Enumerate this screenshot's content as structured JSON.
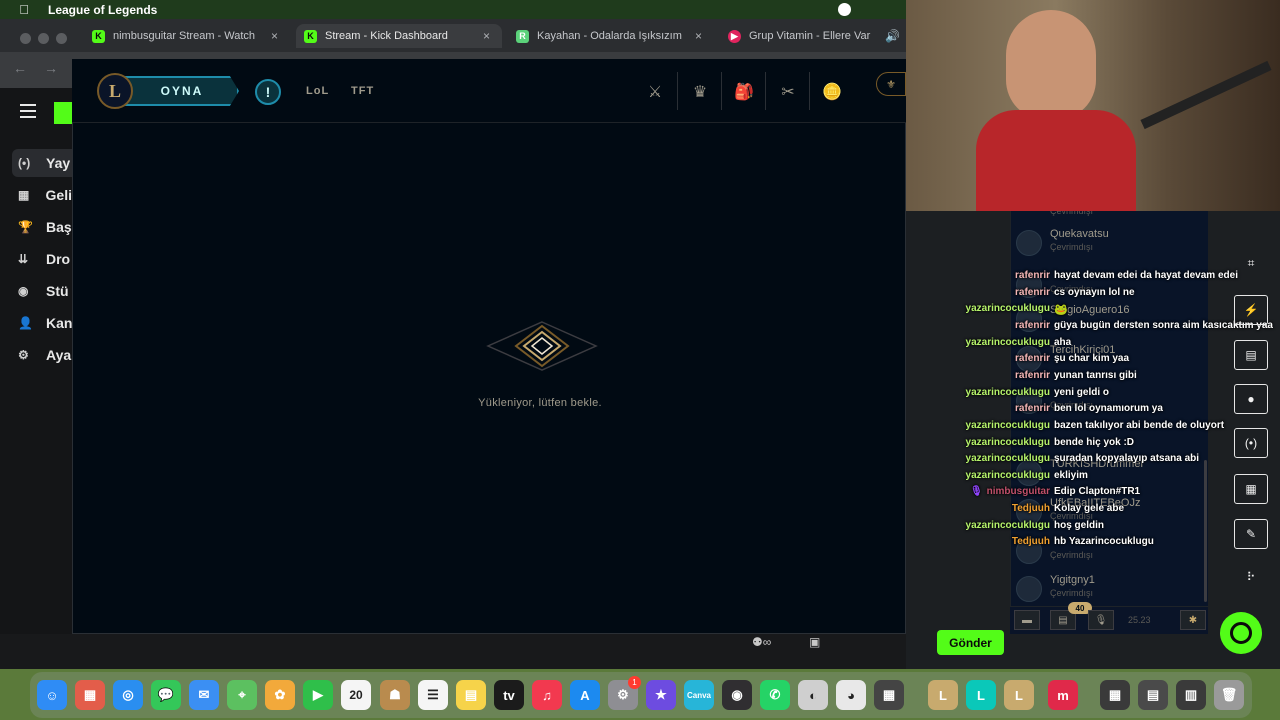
{
  "menubar": {
    "apple": "",
    "app_title": "League of Legends"
  },
  "tabs": [
    {
      "label": "nimbusguitar Stream - Watch",
      "favicon": "K",
      "color": "#53fc18",
      "close": "×"
    },
    {
      "label": "Stream - Kick Dashboard",
      "favicon": "K",
      "color": "#53fc18",
      "close": "×"
    },
    {
      "label": "Kayahan - Odalarda Işıksızım",
      "favicon": "R",
      "color": "#5bd27a",
      "close": "×"
    },
    {
      "label": "Grup Vitamin - Ellere Var",
      "favicon": "▶",
      "color": "#e0245e",
      "close": "🔊"
    }
  ],
  "kick_sidebar": [
    {
      "label": "Yay",
      "icon": "(•)"
    },
    {
      "label": "Geli",
      "icon": "▦"
    },
    {
      "label": "Baş",
      "icon": "🏆"
    },
    {
      "label": "Dro",
      "icon": "⇊"
    },
    {
      "label": "Stü",
      "icon": "◉"
    },
    {
      "label": "Kan",
      "icon": "👤"
    },
    {
      "label": "Aya",
      "icon": "⚙"
    }
  ],
  "lol": {
    "logo": "L",
    "play_label": "OYNA",
    "alert": "!",
    "tabs": [
      "LoL",
      "TFT"
    ],
    "nav_icons": [
      "⚔",
      "♛",
      "🎒",
      "✂",
      "🪙"
    ],
    "currency": "⚜",
    "loading_text": "Yükleniyor, lütfen bekle."
  },
  "friends": [
    {
      "name": "Çevrimdışı",
      "status": ""
    },
    {
      "name": "Quekavatsu",
      "status": "Çevrimdışı"
    },
    {
      "name": "",
      "status": "Çevrimdışı"
    },
    {
      "name": "SergioAguero16",
      "status": ""
    },
    {
      "name": "TercihKirici01",
      "status": ""
    },
    {
      "name": "",
      "status": "Çevrimdışı"
    },
    {
      "name": "TURKISHDrummer",
      "status": ""
    },
    {
      "name": "UfkEBaIITEBeOJz",
      "status": "Çevrimdışı"
    },
    {
      "name": "",
      "status": "Çevrimdışı"
    },
    {
      "name": "Yigitgny1",
      "status": "Çevrimdışı"
    }
  ],
  "friends_bar": {
    "badge": "40",
    "time": "25.23"
  },
  "chat": [
    {
      "user": "rafenrir",
      "msg": "hayat devam edei da hayat devam edei",
      "color": "#f4b6b6"
    },
    {
      "user": "rafenrir",
      "msg": "cs oynayın lol ne",
      "color": "#f4b6b6"
    },
    {
      "user": "yazarincocuklugu",
      "msg": "",
      "color": "#b6f36b"
    },
    {
      "user": "rafenrir",
      "msg": "güya bugün dersten sonra aim kasıcaktım yaa",
      "color": "#f4b6b6"
    },
    {
      "user": "yazarincocuklugu",
      "msg": "aha",
      "color": "#b6f36b"
    },
    {
      "user": "rafenrir",
      "msg": "şu char kim yaa",
      "color": "#f4b6b6"
    },
    {
      "user": "rafenrir",
      "msg": "yunan tanrısı gibi",
      "color": "#f4b6b6"
    },
    {
      "user": "yazarincocuklugu",
      "msg": "yeni geldi o",
      "color": "#b6f36b"
    },
    {
      "user": "rafenrir",
      "msg": "ben lol oynamıorum ya",
      "color": "#f4b6b6"
    },
    {
      "user": "yazarincocuklugu",
      "msg": "bazen takılıyor abi bende de oluyort",
      "color": "#b6f36b"
    },
    {
      "user": "yazarincocuklugu",
      "msg": "bende hiç yok :D",
      "color": "#b6f36b"
    },
    {
      "user": "yazarincocuklugu",
      "msg": "şuradan kopyalayıp atsana abi",
      "color": "#b6f36b"
    },
    {
      "user": "yazarincocuklugu",
      "msg": "ekliyim",
      "color": "#b6f36b"
    },
    {
      "user": "nimbusguitar",
      "msg": "Edip Clapton#TR1",
      "color": "#c0506a"
    },
    {
      "user": "Tedjuuh",
      "msg": "Kolay gele abe",
      "color": "#f0a030"
    },
    {
      "user": "yazarincocuklugu",
      "msg": "hoş geldin",
      "color": "#b6f36b"
    },
    {
      "user": "Tedjuuh",
      "msg": "hb Yazarincocuklugu",
      "color": "#f0a030"
    }
  ],
  "kick_bottom": {
    "send_label": "Gönder"
  },
  "dock": [
    {
      "name": "finder",
      "glyph": "☺",
      "color": "#2f8cf5"
    },
    {
      "name": "launchpad",
      "glyph": "▦",
      "color": "#e35d4a"
    },
    {
      "name": "safari",
      "glyph": "◎",
      "color": "#2a8ef0"
    },
    {
      "name": "messages",
      "glyph": "💬",
      "color": "#34c759"
    },
    {
      "name": "mail",
      "glyph": "✉",
      "color": "#3b8ff3"
    },
    {
      "name": "maps",
      "glyph": "⌖",
      "color": "#5cc060"
    },
    {
      "name": "photos",
      "glyph": "✿",
      "color": "#f2a93b"
    },
    {
      "name": "facetime",
      "glyph": "▶",
      "color": "#2fbf4a"
    },
    {
      "name": "calendar",
      "glyph": "20",
      "color": "#f5f5f5"
    },
    {
      "name": "contacts",
      "glyph": "☗",
      "color": "#b98b4e"
    },
    {
      "name": "reminders",
      "glyph": "☰",
      "color": "#f5f5f5"
    },
    {
      "name": "notes",
      "glyph": "▤",
      "color": "#f6d34a"
    },
    {
      "name": "tv",
      "glyph": "tv",
      "color": "#1b1b1b"
    },
    {
      "name": "music",
      "glyph": "♫",
      "color": "#f2394f"
    },
    {
      "name": "appstore",
      "glyph": "A",
      "color": "#1c8af0"
    },
    {
      "name": "settings",
      "glyph": "⚙",
      "color": "#8e8e93"
    },
    {
      "name": "imovie",
      "glyph": "★",
      "color": "#6d4ce0"
    },
    {
      "name": "canva",
      "glyph": "Canva",
      "color": "#27b5d8"
    },
    {
      "name": "obs",
      "glyph": "◉",
      "color": "#302e31"
    },
    {
      "name": "whatsapp",
      "glyph": "✆",
      "color": "#25d366"
    },
    {
      "name": "disk-utility",
      "glyph": "◐",
      "color": "#cfcfcf"
    },
    {
      "name": "chrome",
      "glyph": "◕",
      "color": "#e8e8e8"
    },
    {
      "name": "calculator",
      "glyph": "▦",
      "color": "#444444"
    },
    {
      "name": "lol-1",
      "glyph": "L",
      "color": "#c8aa6e"
    },
    {
      "name": "lol-2",
      "glyph": "L",
      "color": "#0ac8b9"
    },
    {
      "name": "lol-3",
      "glyph": "L",
      "color": "#c8aa6e"
    },
    {
      "name": "meetup",
      "glyph": "m",
      "color": "#e0294a"
    },
    {
      "name": "window-1",
      "glyph": "▦",
      "color": "#3a3a3a"
    },
    {
      "name": "window-2",
      "glyph": "▤",
      "color": "#4a4a4a"
    },
    {
      "name": "window-3",
      "glyph": "▥",
      "color": "#3a3a3a"
    },
    {
      "name": "trash",
      "glyph": "🗑",
      "color": "#9a9a9a"
    }
  ],
  "dock_badge": "1"
}
